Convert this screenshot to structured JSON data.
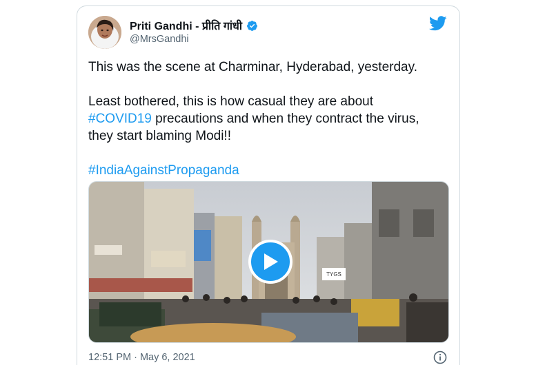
{
  "tweet": {
    "author": {
      "display_name": "Priti Gandhi - प्रीति गांधी",
      "handle": "@MrsGandhi",
      "verified_icon": "verified-badge-icon",
      "avatar": "avatar"
    },
    "brand_icon": "twitter-bird-icon",
    "text": {
      "line1": "This was the scene at Charminar, Hyderabad, yesterday.",
      "para2_before": "Least bothered, this is how casual they are about",
      "hashtag1": "#COVID19",
      "para2_after_line1": " precautions and when they contract the virus,",
      "para2_line3": "they start blaming Modi!!",
      "hashtag2": "#IndiaAgainstPropaganda"
    },
    "media": {
      "type": "video",
      "play_icon": "play-icon",
      "sign_text": "TYGS"
    },
    "timestamp": "12:51 PM · May 6, 2021",
    "info_icon": "info-icon"
  },
  "colors": {
    "accent": "#1d9bf0",
    "text": "#0f1419",
    "secondary": "#536471",
    "border": "#cfd9de"
  }
}
